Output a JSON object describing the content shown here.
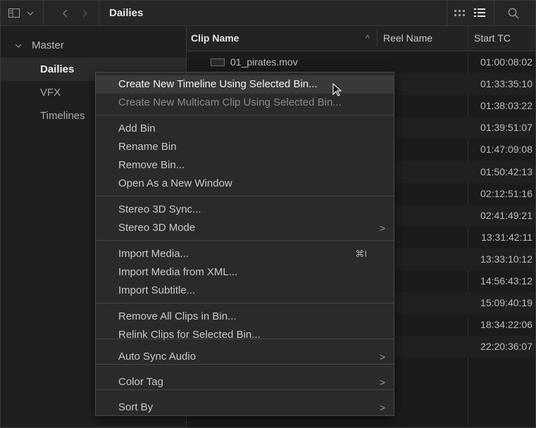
{
  "topbar": {
    "title": "Dailies",
    "icons": [
      "panel-icon",
      "chevron-down-icon",
      "back-icon",
      "forward-icon",
      "grid-view-icon",
      "list-view-icon",
      "search-icon"
    ]
  },
  "sidebar": {
    "master_label": "Master",
    "items": [
      {
        "label": "Dailies",
        "selected": true
      },
      {
        "label": "VFX",
        "selected": false
      },
      {
        "label": "Timelines",
        "selected": false
      }
    ]
  },
  "table": {
    "columns": {
      "clip_name": "Clip Name",
      "reel_name": "Reel Name",
      "start_tc": "Start TC"
    },
    "first_clip_name": "01_pirates.mov",
    "start_tc_values": [
      "01:00:08:02",
      "01:33:35:10",
      "01:38:03:22",
      "01:39:51:07",
      "01:47:09:08",
      "01:50:42:13",
      "02:12:51:16",
      "02:41:49:21",
      "13:31:42:11",
      "13:33:10:12",
      "14:56:43:12",
      "15:09:40:19",
      "18:34:22:06",
      "22:20:36:07"
    ]
  },
  "context_menu": {
    "items": [
      {
        "label": "Create New Timeline Using Selected Bin...",
        "highlight": true
      },
      {
        "label": "Create New Multicam Clip Using Selected Bin...",
        "dim": true
      },
      {
        "label": "Add Bin"
      },
      {
        "label": "Rename Bin"
      },
      {
        "label": "Remove Bin..."
      },
      {
        "label": "Open As a New Window"
      },
      {
        "label": "Stereo 3D Sync..."
      },
      {
        "label": "Stereo 3D Mode",
        "submenu": true
      },
      {
        "label": "Import Media...",
        "shortcut": "⌘I"
      },
      {
        "label": "Import Media from XML..."
      },
      {
        "label": "Import Subtitle..."
      },
      {
        "label": "Remove All Clips in Bin..."
      },
      {
        "label": "Relink Clips for Selected Bin..."
      },
      {
        "label": "Auto Sync Audio",
        "submenu": true
      },
      {
        "label": "Color Tag",
        "submenu": true
      },
      {
        "label": "Sort By",
        "submenu": true
      }
    ],
    "arrow_glyph": ">"
  }
}
